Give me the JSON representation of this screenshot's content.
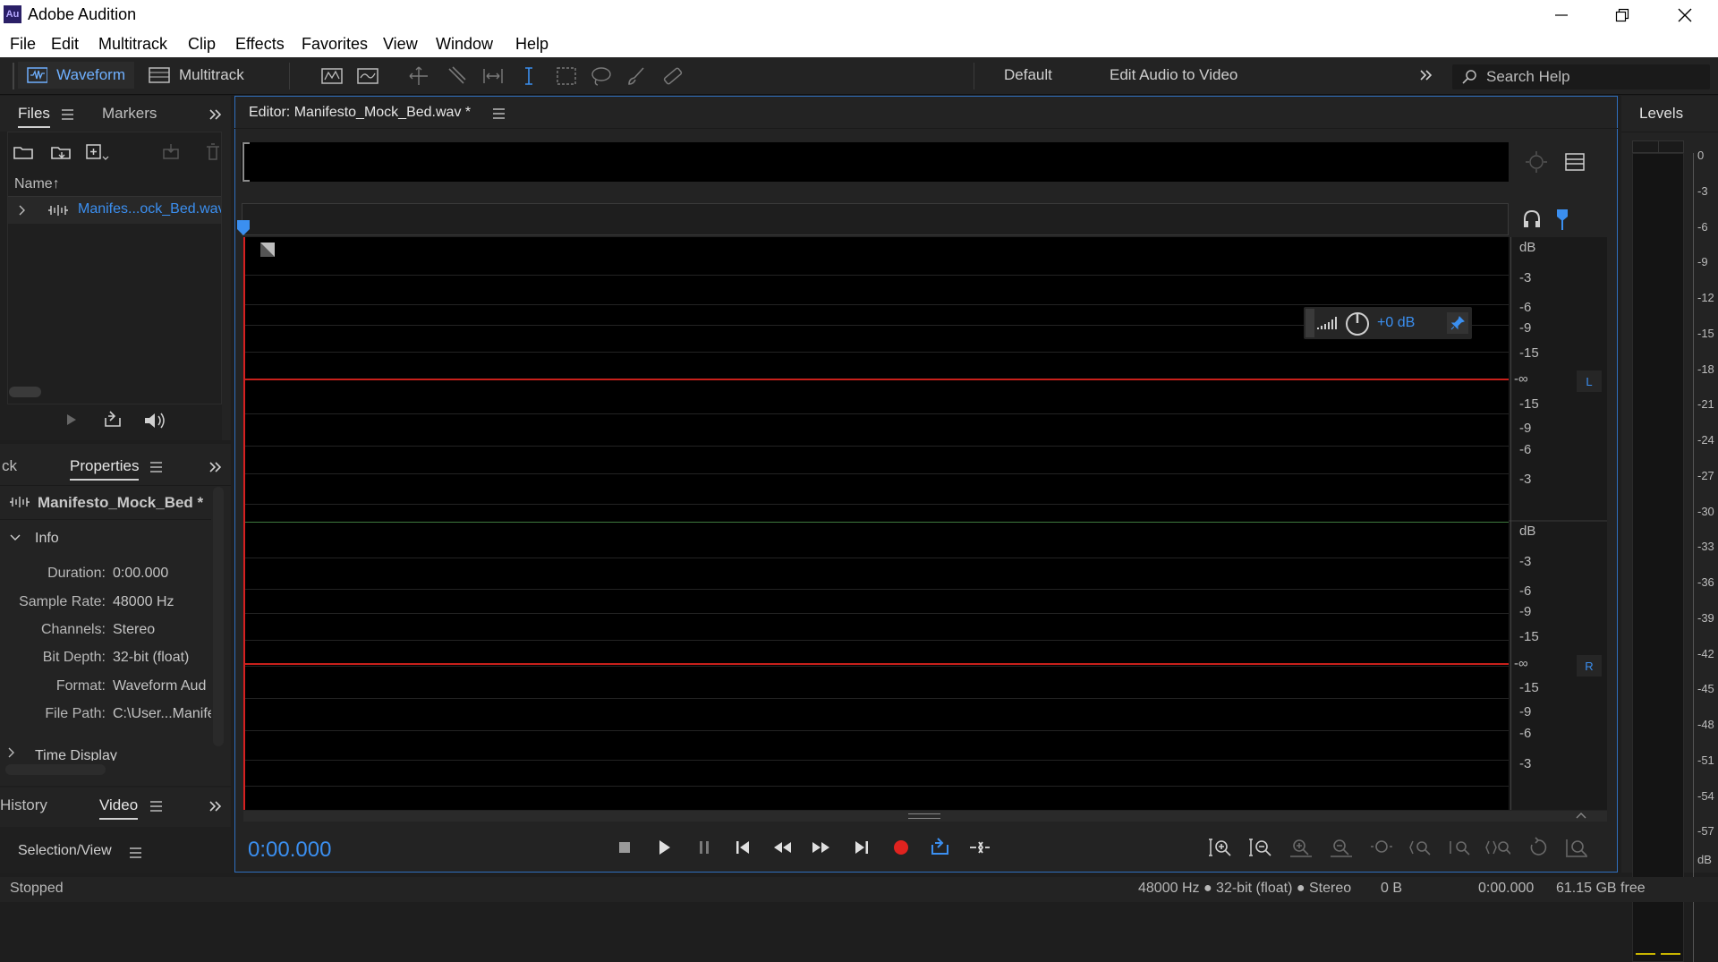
{
  "app": {
    "title": "Adobe Audition",
    "logo": "Au"
  },
  "menu": [
    "File",
    "Edit",
    "Multitrack",
    "Clip",
    "Effects",
    "Favorites",
    "View",
    "Window",
    "Help"
  ],
  "toolbar": {
    "waveform_label": "Waveform",
    "multitrack_label": "Multitrack",
    "workspace_default": "Default",
    "workspace_edit_video": "Edit Audio to Video",
    "search_placeholder": "Search Help"
  },
  "files_panel": {
    "tab_files": "Files",
    "tab_markers": "Markers",
    "column_name": "Name",
    "sort_arrow": "↑",
    "items": [
      {
        "name": "Manifes...ock_Bed.wav"
      }
    ]
  },
  "properties_panel": {
    "tab_left_fragment": "ck",
    "tab_properties": "Properties",
    "file_title": "Manifesto_Mock_Bed *",
    "section_info": "Info",
    "rows": [
      {
        "label": "Duration:",
        "value": "0:00.000"
      },
      {
        "label": "Sample Rate:",
        "value": "48000 Hz"
      },
      {
        "label": "Channels:",
        "value": "Stereo"
      },
      {
        "label": "Bit Depth:",
        "value": "32-bit (float)"
      },
      {
        "label": "Format:",
        "value": "Waveform Aud"
      },
      {
        "label": "File Path:",
        "value": "C:\\User...Manife"
      }
    ],
    "section_time_display": "Time Display"
  },
  "bottom_left_panel": {
    "tab_history": "History",
    "tab_video": "Video",
    "tool_label": "Selection/View"
  },
  "editor": {
    "tab_title": "Editor: Manifesto_Mock_Bed.wav *",
    "hud_gain": "+0 dB",
    "channel_left": "L",
    "channel_right": "R",
    "db_scale_top": [
      "dB",
      "-3",
      "-6",
      "-9",
      "-15",
      "-∞",
      "-15",
      "-9",
      "-6",
      "-3"
    ],
    "db_scale_bottom": [
      "dB",
      "-3",
      "-6",
      "-9",
      "-15",
      "-∞",
      "-15",
      "-9",
      "-6",
      "-3"
    ],
    "current_time": "0:00.000"
  },
  "levels": {
    "title": "Levels",
    "scale": [
      "0",
      "-3",
      "-6",
      "-9",
      "-12",
      "-15",
      "-18",
      "-21",
      "-24",
      "-27",
      "-30",
      "-33",
      "-36",
      "-39",
      "-42",
      "-45",
      "-48",
      "-51",
      "-54",
      "-57",
      "dB"
    ]
  },
  "status": {
    "state": "Stopped",
    "format": "48000 Hz ● 32-bit (float) ● Stereo",
    "size": "0 B",
    "duration": "0:00.000",
    "free_space": "61.15 GB free"
  },
  "colors": {
    "accent_blue": "#3b8ff0",
    "record_red": "#e0231f",
    "center_line_red": "#c8201b",
    "center_line_green": "#3f7a3f"
  }
}
